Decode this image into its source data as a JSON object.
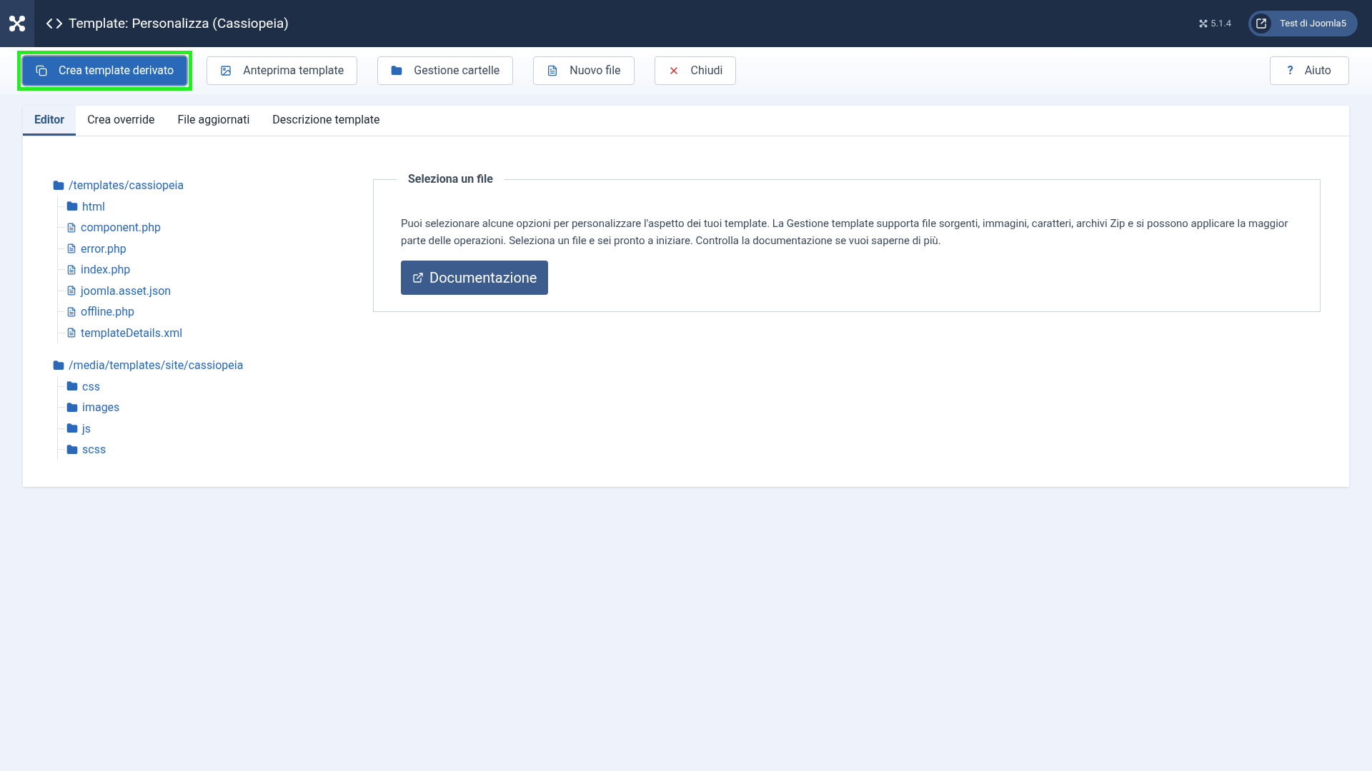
{
  "header": {
    "title": "Template: Personalizza (Cassiopeia)",
    "version": "5.1.4",
    "site_button": "Test di Joomla5"
  },
  "toolbar": {
    "buttons": [
      {
        "label": "Crea template derivato",
        "primary": true,
        "highlighted": true
      },
      {
        "label": "Anteprima template",
        "primary": false,
        "highlighted": false
      },
      {
        "label": "Gestione cartelle",
        "primary": false,
        "highlighted": false
      },
      {
        "label": "Nuovo file",
        "primary": false,
        "highlighted": false
      },
      {
        "label": "Chiudi",
        "primary": false,
        "highlighted": false
      }
    ],
    "help_icon": "?",
    "help_button": "Aiuto"
  },
  "tabs": [
    {
      "label": "Editor",
      "selected": true
    },
    {
      "label": "Crea override",
      "selected": false
    },
    {
      "label": "File aggiornati",
      "selected": false
    },
    {
      "label": "Descrizione template",
      "selected": false
    }
  ],
  "tree": [
    {
      "name": "/templates/cassiopeia",
      "kind": "folder",
      "children": [
        {
          "name": "html",
          "kind": "folder"
        },
        {
          "name": "component.php",
          "kind": "file"
        },
        {
          "name": "error.php",
          "kind": "file"
        },
        {
          "name": "index.php",
          "kind": "file"
        },
        {
          "name": "joomla.asset.json",
          "kind": "file"
        },
        {
          "name": "offline.php",
          "kind": "file"
        },
        {
          "name": "templateDetails.xml",
          "kind": "file"
        }
      ]
    },
    {
      "name": "/media/templates/site/cassiopeia",
      "kind": "folder",
      "children": [
        {
          "name": "css",
          "kind": "folder"
        },
        {
          "name": "images",
          "kind": "folder"
        },
        {
          "name": "js",
          "kind": "folder"
        },
        {
          "name": "scss",
          "kind": "folder"
        }
      ]
    }
  ],
  "panel": {
    "legend": "Seleziona un file",
    "text": "Puoi selezionare alcune opzioni per personalizzare l'aspetto dei tuoi template. La Gestione template supporta file sorgenti, immagini, caratteri, archivi Zip e si possono applicare la maggior parte delle operazioni. Seleziona un file e sei pronto a iniziare. Controlla la documentazione se vuoi saperne di più.",
    "button": "Documentazione"
  }
}
